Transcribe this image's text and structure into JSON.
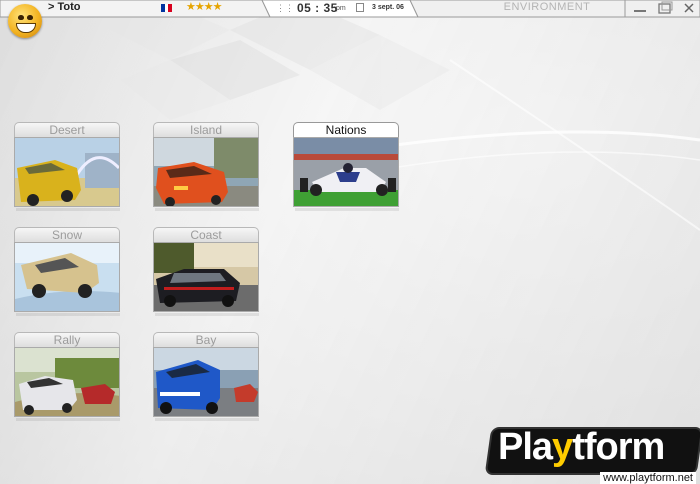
{
  "topbar": {
    "player_name": "> Toto",
    "stars": "★★★★",
    "time": "05 : 35",
    "ampm": "pm",
    "date": "3 sept. 06",
    "section_title": "ENVIRONMENT",
    "flag_colors": [
      "#0033a0",
      "#ffffff",
      "#d8001e"
    ]
  },
  "environments": [
    {
      "label": "Desert",
      "selected": false
    },
    {
      "label": "Island",
      "selected": false
    },
    {
      "label": "Nations",
      "selected": true
    },
    {
      "label": "Snow",
      "selected": false
    },
    {
      "label": "Coast",
      "selected": false
    },
    {
      "label": "Rally",
      "selected": false
    },
    {
      "label": "Bay",
      "selected": false
    }
  ],
  "watermark": {
    "brand_pre": "Pla",
    "brand_y": "y",
    "brand_post": "tform",
    "url": "www.playtform.net"
  }
}
